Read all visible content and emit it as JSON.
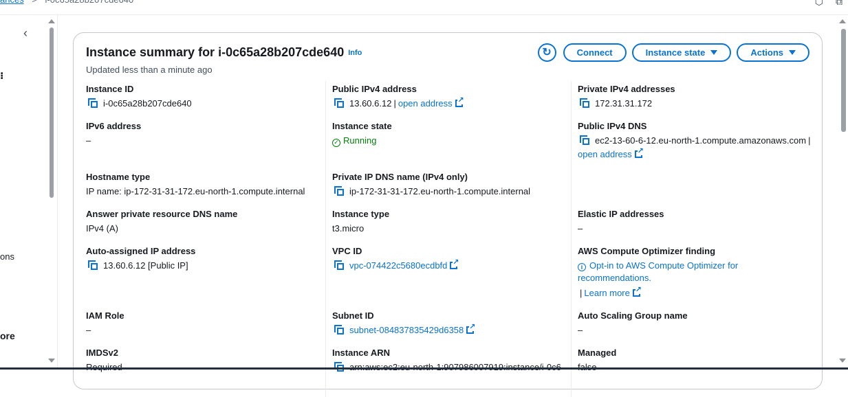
{
  "breadcrumb": {
    "parent": "ances",
    "separator": ">",
    "current": "i-0c65a28b207cde640"
  },
  "leftnav": {
    "fragment_1": "ons",
    "fragment_2": "ore"
  },
  "summary": {
    "title": "Instance summary for i-0c65a28b207cde640",
    "info": "Info",
    "updated": "Updated less than a minute ago",
    "buttons": {
      "connect": "Connect",
      "instance_state": "Instance state",
      "actions": "Actions"
    }
  },
  "fields": {
    "instance_id": {
      "label": "Instance ID",
      "value": "i-0c65a28b207cde640"
    },
    "public_ipv4": {
      "label": "Public IPv4 address",
      "value": "13.60.6.12",
      "link": "open address"
    },
    "private_ipv4": {
      "label": "Private IPv4 addresses",
      "value": "172.31.31.172"
    },
    "ipv6": {
      "label": "IPv6 address",
      "value": "–"
    },
    "instance_state": {
      "label": "Instance state",
      "value": "Running"
    },
    "public_dns": {
      "label": "Public IPv4 DNS",
      "value": "ec2-13-60-6-12.eu-north-1.compute.amazonaws.com",
      "link": "open address"
    },
    "hostname_type": {
      "label": "Hostname type",
      "value": "IP name: ip-172-31-31-172.eu-north-1.compute.internal"
    },
    "private_dns": {
      "label": "Private IP DNS name (IPv4 only)",
      "value": "ip-172-31-31-172.eu-north-1.compute.internal"
    },
    "answer_dns": {
      "label": "Answer private resource DNS name",
      "value": "IPv4 (A)"
    },
    "instance_type": {
      "label": "Instance type",
      "value": "t3.micro"
    },
    "elastic_ip": {
      "label": "Elastic IP addresses",
      "value": "–"
    },
    "auto_ip": {
      "label": "Auto-assigned IP address",
      "value": "13.60.6.12 [Public IP]"
    },
    "vpc_id": {
      "label": "VPC ID",
      "value": "vpc-074422c5680ecdbfd"
    },
    "optimizer": {
      "label": "AWS Compute Optimizer finding",
      "value": "Opt-in to AWS Compute Optimizer for recommendations.",
      "link": "Learn more"
    },
    "iam_role": {
      "label": "IAM Role",
      "value": "–"
    },
    "subnet_id": {
      "label": "Subnet ID",
      "value": "subnet-084837835429d6358"
    },
    "asg_name": {
      "label": "Auto Scaling Group name",
      "value": "–"
    },
    "imdsv2": {
      "label": "IMDSv2",
      "value": "Required"
    },
    "instance_arn": {
      "label": "Instance ARN",
      "value": "arn:aws:ec2:eu-north-1:907986007919:instance/i-0c6"
    },
    "managed": {
      "label": "Managed",
      "value": "false"
    }
  },
  "colors": {
    "link": "#0972d3",
    "success": "#037f0c",
    "border": "#c6c6cd"
  }
}
